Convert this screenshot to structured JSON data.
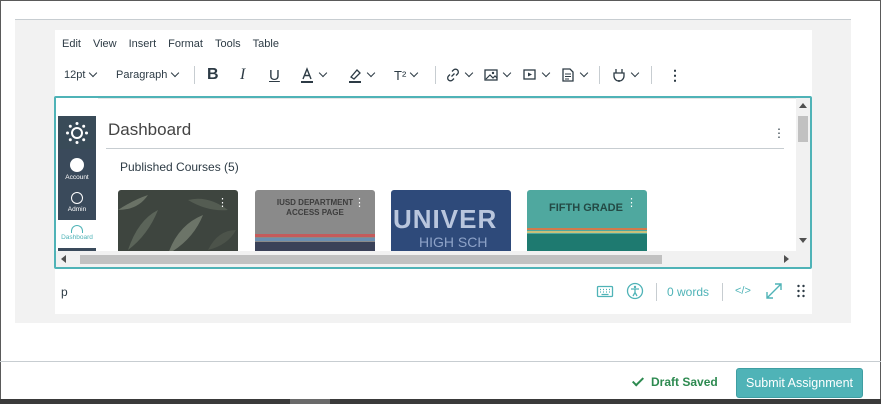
{
  "menu": [
    "Edit",
    "View",
    "Insert",
    "Format",
    "Tools",
    "Table"
  ],
  "toolbar": {
    "font_size": "12pt",
    "block_format": "Paragraph",
    "bold_icon": "bold-icon",
    "italic_icon": "italic-icon",
    "underline_icon": "underline-icon",
    "text_color_icon": "text-color-icon",
    "highlight_icon": "highlight-icon",
    "superscript_icon": "superscript-icon",
    "link_icon": "link-icon",
    "image_icon": "image-icon",
    "media_icon": "media-icon",
    "document_icon": "document-icon",
    "apps_icon": "apps-icon",
    "more_icon": "more-icon"
  },
  "embedded": {
    "nav": [
      {
        "label": "Account"
      },
      {
        "label": "Admin"
      },
      {
        "label": "Dashboard"
      }
    ],
    "dashboard_title": "Dashboard",
    "published_title": "Published Courses (5)",
    "cards": [
      {
        "text": "",
        "color": "#3e453f"
      },
      {
        "text": "IUSD DEPARTMENT ACCESS PAGE",
        "color": "#8a8a8a"
      },
      {
        "text": "UNIVER",
        "sub": "HIGH SCH",
        "color": "#2e4a7a"
      },
      {
        "text": "FIFTH GRADE",
        "color": "#4fa89f"
      }
    ]
  },
  "status": {
    "element_path": "p",
    "keyboard_icon": "keyboard-icon",
    "accessibility_icon": "accessibility-icon",
    "word_count": "0 words",
    "html_toggle": "</>",
    "fullscreen_icon": "fullscreen-icon",
    "resize_icon": "resize-handle-icon"
  },
  "footer": {
    "draft_status": "Draft Saved",
    "submit_label": "Submit Assignment"
  },
  "colors": {
    "accent": "#4fb3b7",
    "success": "#2d8a50",
    "nav_bg": "#3a4a5b"
  }
}
